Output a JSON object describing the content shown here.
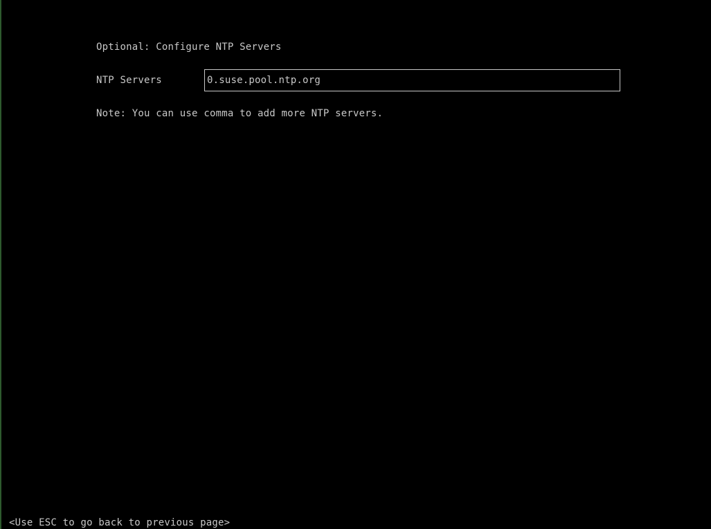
{
  "page": {
    "title": "Optional: Configure NTP Servers",
    "footer_hint": "<Use ESC to go back to previous page>"
  },
  "form": {
    "ntp_servers": {
      "label": "NTP Servers",
      "value": "0.suse.pool.ntp.org"
    },
    "note": "Note: You can use comma to add more NTP servers."
  },
  "colors": {
    "background": "#000000",
    "text": "#c8c8c8",
    "left_edge": "#2e5a2e"
  }
}
